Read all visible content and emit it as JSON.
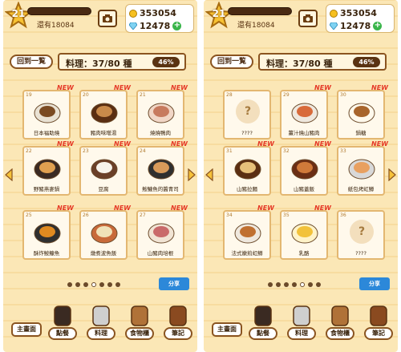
{
  "colors": {
    "accent": "#8a5420",
    "new_badge": "#e53927",
    "share": "#2c88d9",
    "plus": "#39b54a"
  },
  "screens": [
    {
      "level": "21",
      "exp_text": "還有18084",
      "coins": "353054",
      "gems": "12478",
      "back_label": "回到一覧",
      "title": "料理：37/80 種",
      "percent": "46%",
      "cards": [
        {
          "idx": "19",
          "name": "日本福助燒",
          "new": "NEW",
          "icon": "grilled-fish-icon"
        },
        {
          "idx": "20",
          "name": "豬肉味噌湯",
          "new": "NEW",
          "icon": "miso-soup-icon"
        },
        {
          "idx": "21",
          "name": "燒燒鴨肉",
          "new": "NEW",
          "icon": "sliced-duck-icon"
        },
        {
          "idx": "22",
          "name": "野豬燕麥鍋",
          "new": "NEW",
          "icon": "hotpot-icon"
        },
        {
          "idx": "23",
          "name": "豆腐",
          "new": "NEW",
          "icon": "tofu-icon"
        },
        {
          "idx": "24",
          "name": "鮟鱇魚的醬青司",
          "new": "NEW",
          "icon": "fish-hotpot-icon"
        },
        {
          "idx": "25",
          "name": "酥炸鮟鱇魚",
          "new": "NEW",
          "icon": "fried-fish-icon"
        },
        {
          "idx": "26",
          "name": "燉煮波魚飯",
          "new": "NEW",
          "icon": "gratin-icon"
        },
        {
          "idx": "27",
          "name": "山豬肉培根",
          "new": "NEW",
          "icon": "bacon-icon"
        }
      ],
      "page_dots": 7,
      "active_dot": 3,
      "share_label": "分享",
      "nav": {
        "main": "主畫面",
        "order": "點餐",
        "cooking": "料理",
        "pantry": "食物櫃",
        "notes": "筆記"
      }
    },
    {
      "level": "21",
      "exp_text": "還有18084",
      "coins": "353054",
      "gems": "12478",
      "back_label": "回到一覧",
      "title": "料理：37/80 種",
      "percent": "46%",
      "cards": [
        {
          "idx": "28",
          "name": "????",
          "new": "",
          "icon": "unknown-icon"
        },
        {
          "idx": "29",
          "name": "薑汁燒山豬肉",
          "new": "NEW",
          "icon": "ginger-pork-icon"
        },
        {
          "idx": "30",
          "name": "鍋糖",
          "new": "NEW",
          "icon": "sweet-icon"
        },
        {
          "idx": "31",
          "name": "山豬拉麵",
          "new": "NEW",
          "icon": "ramen-icon"
        },
        {
          "idx": "32",
          "name": "山豬蓋飯",
          "new": "NEW",
          "icon": "rice-bowl-icon"
        },
        {
          "idx": "33",
          "name": "紙包烤虹鱒",
          "new": "NEW",
          "icon": "foil-fish-icon"
        },
        {
          "idx": "34",
          "name": "法式嫩煎虹鱒",
          "new": "NEW",
          "icon": "sauteed-fish-icon"
        },
        {
          "idx": "35",
          "name": "乳酪",
          "new": "NEW",
          "icon": "cheese-icon"
        },
        {
          "idx": "36",
          "name": "????",
          "new": "",
          "icon": "unknown-icon"
        }
      ],
      "page_dots": 7,
      "active_dot": 4,
      "share_label": "分享",
      "nav": {
        "main": "主畫面",
        "order": "點餐",
        "cooking": "料理",
        "pantry": "食物櫃",
        "notes": "筆記"
      }
    }
  ]
}
